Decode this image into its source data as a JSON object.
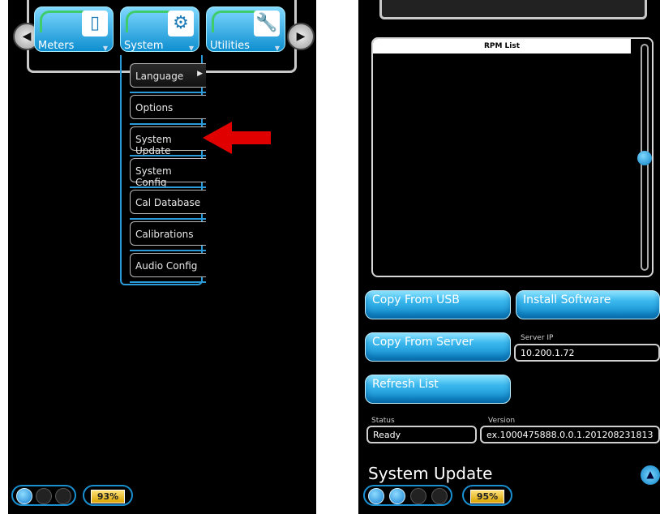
{
  "left": {
    "nav": {
      "tabs": [
        {
          "label": "Meters",
          "icon": "meter-icon"
        },
        {
          "label": "System",
          "icon": "gear-icon"
        },
        {
          "label": "Utilities",
          "icon": "wrench-icon"
        }
      ]
    },
    "menu": {
      "items": [
        "Language",
        "Options",
        "System Update",
        "System Config",
        "Cal Database",
        "Calibrations",
        "Audio Config"
      ]
    },
    "battery": "93%"
  },
  "right": {
    "rpm_list": {
      "title": "RPM List"
    },
    "buttons": {
      "copy_usb": "Copy From USB",
      "install": "Install Software",
      "copy_server": "Copy From Server",
      "refresh": "Refresh List"
    },
    "server_ip": {
      "label": "Server IP",
      "value": "10.200.1.72"
    },
    "status": {
      "label": "Status",
      "value": "Ready"
    },
    "version": {
      "label": "Version",
      "value": "ex.1000475888.0.0.1.201208231813"
    },
    "title": "System Update",
    "battery": "95%"
  },
  "colors": {
    "accent": "#1a8fd0",
    "highlight_arrow": "#e00000",
    "status_green": "#3fcc6a"
  }
}
